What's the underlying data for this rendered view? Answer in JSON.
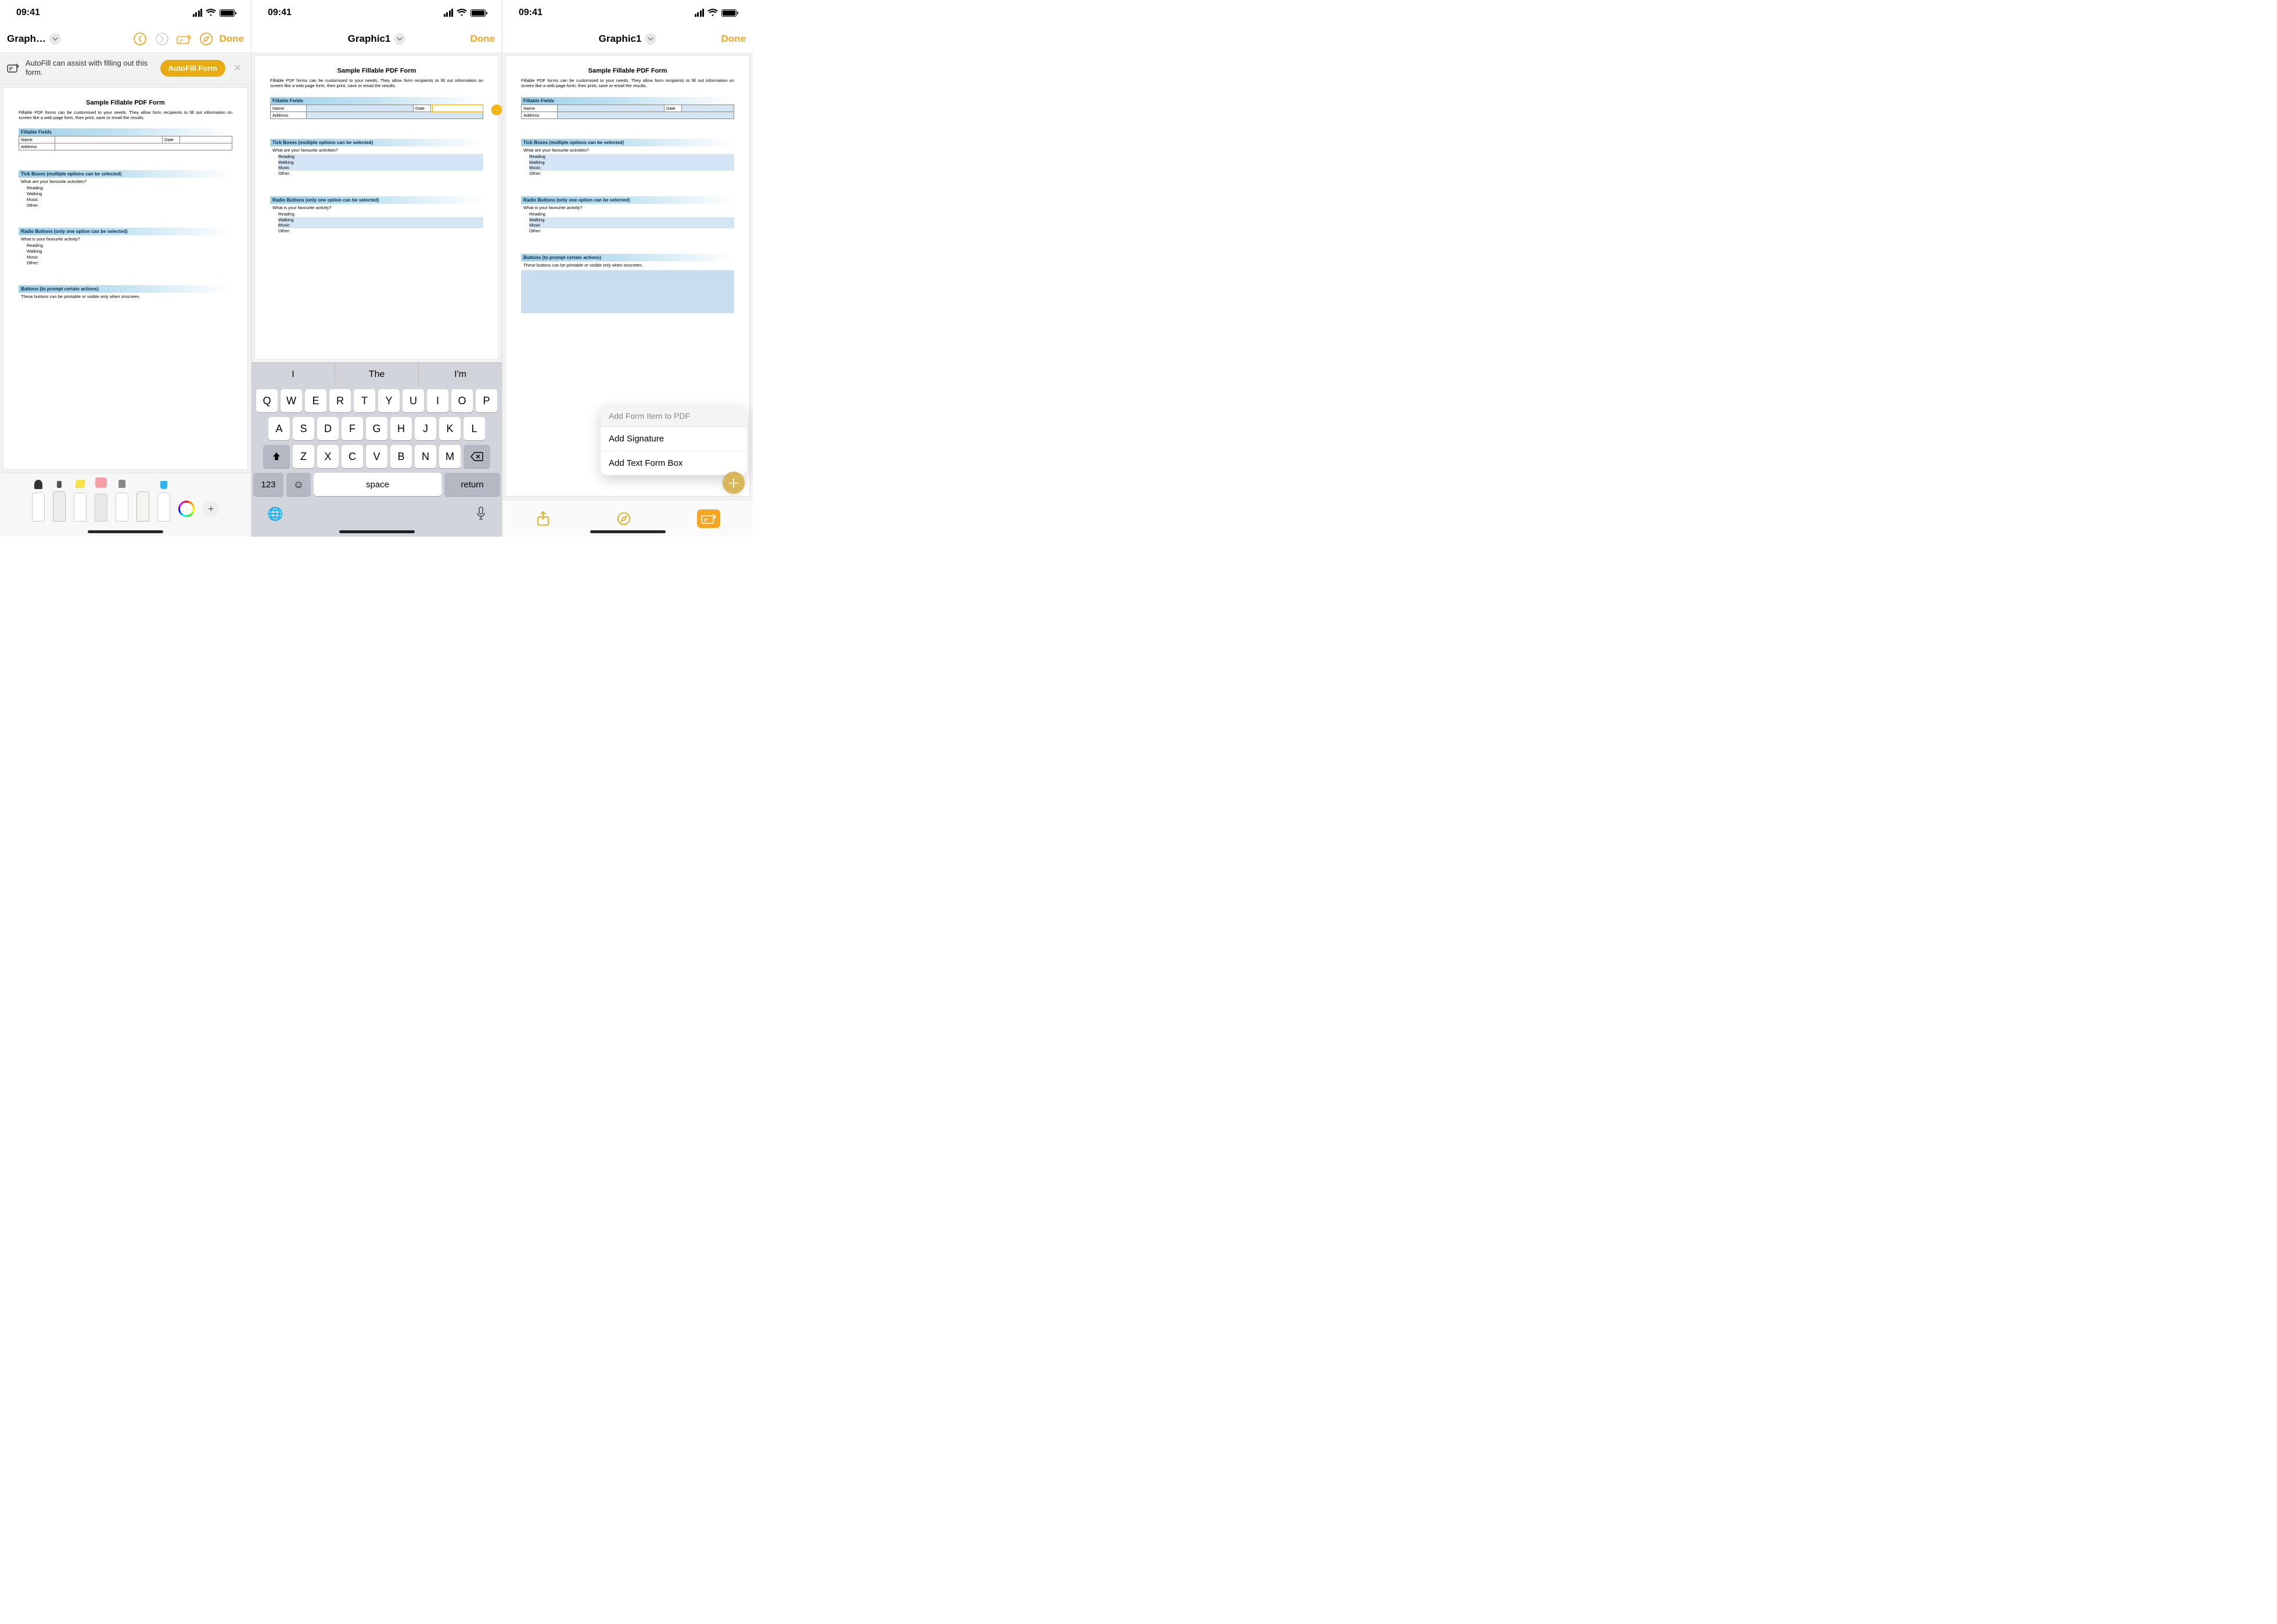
{
  "status": {
    "time": "09:41"
  },
  "nav": {
    "title_truncated": "Graph…",
    "title_full": "Graphic1",
    "done": "Done"
  },
  "autofill": {
    "text": "AutoFill can assist with filling out this form.",
    "button": "AutoFill Form"
  },
  "doc": {
    "title": "Sample Fillable PDF Form",
    "intro": "Fillable PDF forms can be customised to your needs. They allow form recipients to fill out information on screen like a web page form, then print, save or email the results.",
    "sections": {
      "fillable": {
        "heading": "Fillable Fields",
        "name": "Name",
        "date": "Date",
        "address": "Address"
      },
      "tick": {
        "heading": "Tick Boxes (multiple options can be selected)",
        "question": "What are your favourite activities?",
        "opts": [
          "Reading",
          "Walking",
          "Music",
          "Other:"
        ]
      },
      "radio": {
        "heading": "Radio Buttons (only one option can be selected)",
        "question": "What is your favourite activity?",
        "opts": [
          "Reading",
          "Walking",
          "Music",
          "Other:"
        ]
      },
      "buttons": {
        "heading": "Buttons (to prompt certain actions)",
        "note": "These buttons can be printable or visible only when onscreen."
      }
    }
  },
  "keyboard": {
    "suggestions": [
      "I",
      "The",
      "I'm"
    ],
    "row1": [
      "Q",
      "W",
      "E",
      "R",
      "T",
      "Y",
      "U",
      "I",
      "O",
      "P"
    ],
    "row2": [
      "A",
      "S",
      "D",
      "F",
      "G",
      "H",
      "J",
      "K",
      "L"
    ],
    "row3": [
      "Z",
      "X",
      "C",
      "V",
      "B",
      "N",
      "M"
    ],
    "num": "123",
    "space": "space",
    "return": "return"
  },
  "popup": {
    "header": "Add Form Item to PDF",
    "items": [
      "Add Signature",
      "Add Text Form Box"
    ]
  }
}
